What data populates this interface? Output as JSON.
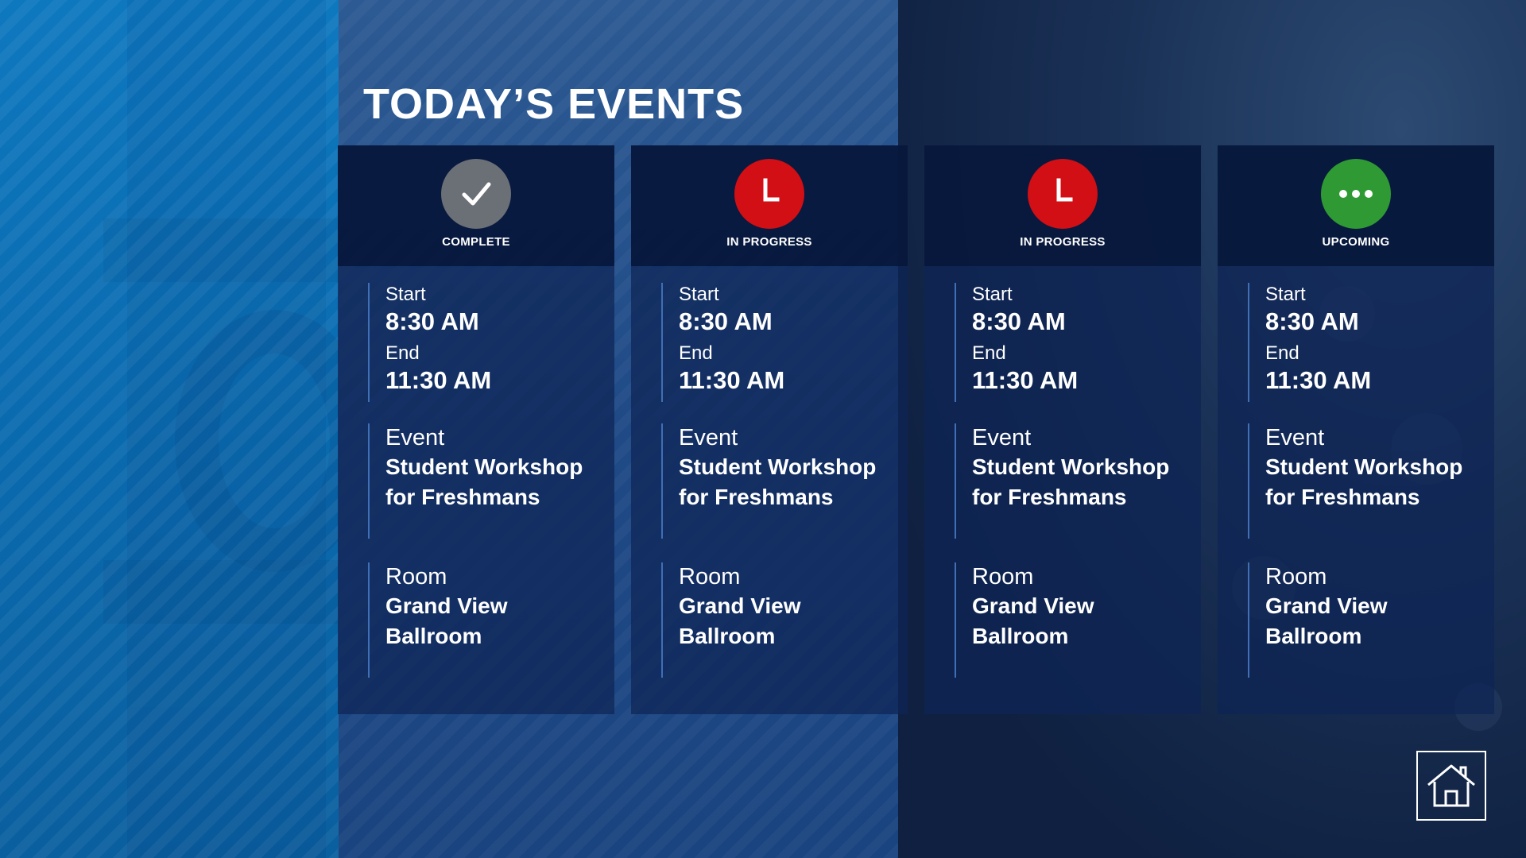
{
  "page": {
    "title": "TODAY’S EVENTS"
  },
  "colors": {
    "complete": "#6b6f76",
    "in_progress": "#d10f14",
    "upcoming": "#2f9a33",
    "accent_line": "#3f6fb6"
  },
  "events": [
    {
      "status": "COMPLETE",
      "status_icon": "checkmark-icon",
      "start_label": "Start",
      "start": "8:30 AM",
      "end_label": "End",
      "end": "11:30 AM",
      "event_label": "Event",
      "event": "Student Workshop for Freshmans",
      "room_label": "Room",
      "room": "Grand View Ballroom"
    },
    {
      "status": "IN PROGRESS",
      "status_icon": "clock-icon",
      "start_label": "Start",
      "start": "8:30 AM",
      "end_label": "End",
      "end": "11:30 AM",
      "event_label": "Event",
      "event": "Student Workshop for Freshmans",
      "room_label": "Room",
      "room": "Grand View Ballroom"
    },
    {
      "status": "IN PROGRESS",
      "status_icon": "clock-icon",
      "start_label": "Start",
      "start": "8:30 AM",
      "end_label": "End",
      "end": "11:30 AM",
      "event_label": "Event",
      "event": "Student Workshop for Freshmans",
      "room_label": "Room",
      "room": "Grand View Ballroom"
    },
    {
      "status": "UPCOMING",
      "status_icon": "ellipsis-icon",
      "start_label": "Start",
      "start": "8:30 AM",
      "end_label": "End",
      "end": "11:30 AM",
      "event_label": "Event",
      "event": "Student Workshop for Freshmans",
      "room_label": "Room",
      "room": "Grand View Ballroom"
    }
  ],
  "home": {
    "icon": "home-icon"
  }
}
